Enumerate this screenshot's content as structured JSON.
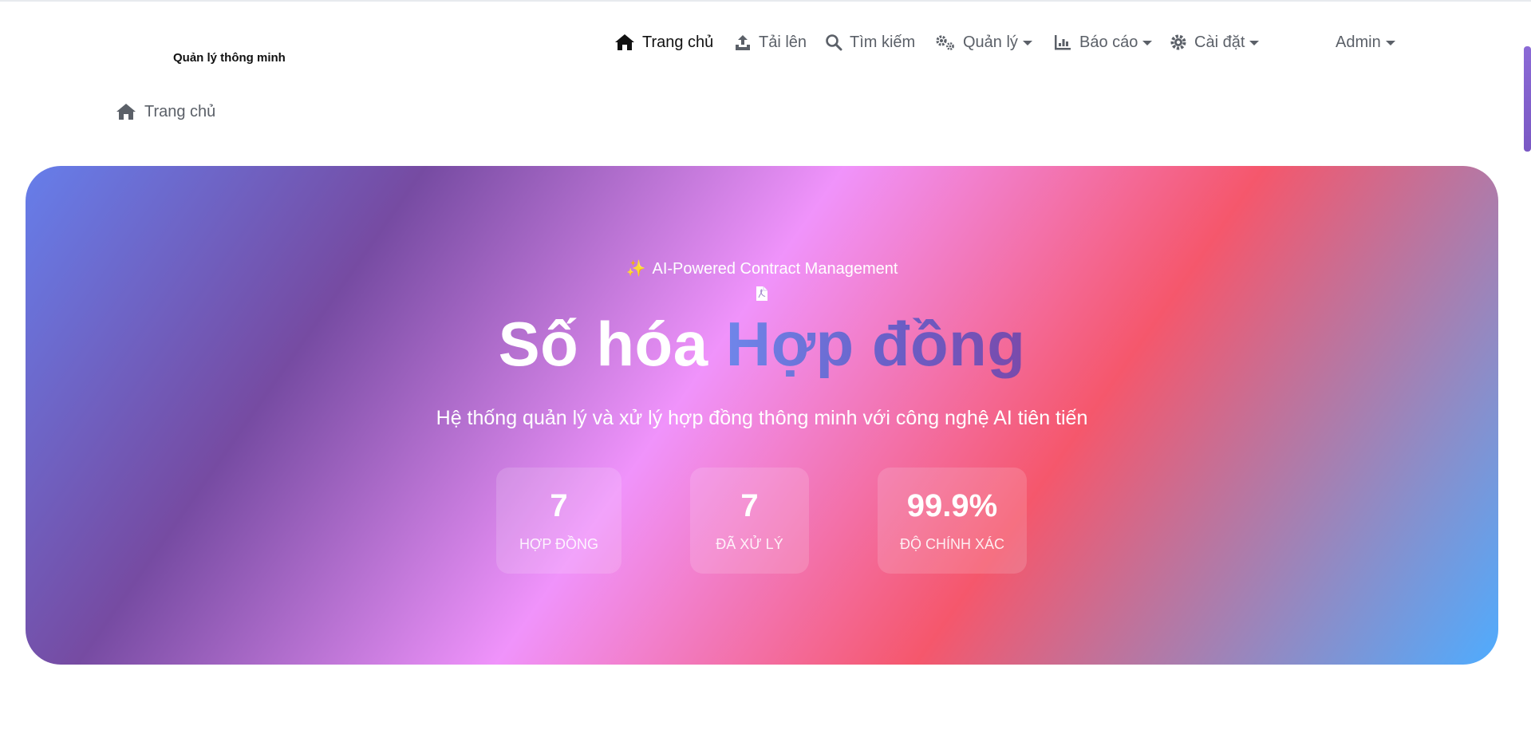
{
  "brand": {
    "name": "Quản lý thông minh"
  },
  "nav": {
    "items": [
      {
        "label": "Trang chủ",
        "icon": "home-icon",
        "active": true
      },
      {
        "label": "Tải lên",
        "icon": "upload-icon"
      },
      {
        "label": "Tìm kiếm",
        "icon": "search-icon"
      },
      {
        "label": "Quản lý",
        "icon": "gears-icon",
        "dropdown": true
      },
      {
        "label": "Báo cáo",
        "icon": "chart-icon",
        "dropdown": true
      },
      {
        "label": "Cài đặt",
        "icon": "gear-icon",
        "dropdown": true
      }
    ],
    "user": {
      "label": "Admin",
      "dropdown": true
    }
  },
  "breadcrumb": {
    "label": "Trang chủ",
    "icon": "home-icon"
  },
  "hero": {
    "tag": {
      "emoji": "✨",
      "text": "AI-Powered Contract Management"
    },
    "title_plain": "Số hóa",
    "title_accent": "Hợp đồng",
    "subtitle": "Hệ thống quản lý và xử lý hợp đồng thông minh với công nghệ AI tiên tiến",
    "stats": [
      {
        "value": "7",
        "label": "HỢP ĐỒNG"
      },
      {
        "value": "7",
        "label": "ĐÃ XỬ LÝ"
      },
      {
        "value": "99.9%",
        "label": "ĐỘ CHÍNH XÁC"
      }
    ],
    "gradient_colors": [
      "#667eea",
      "#764ba2",
      "#f093fb",
      "#f5576c",
      "#4facfe"
    ]
  }
}
